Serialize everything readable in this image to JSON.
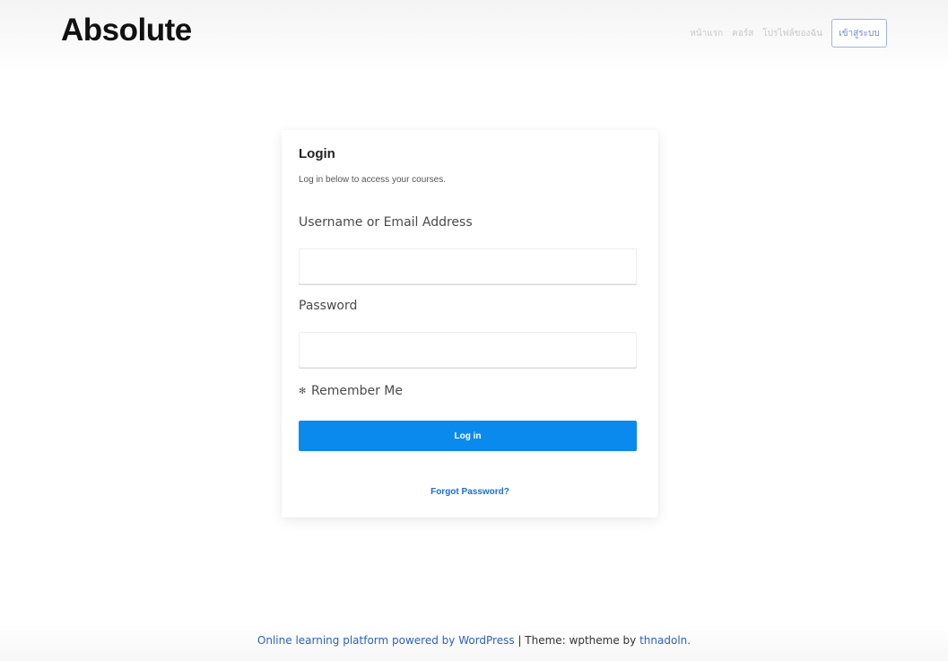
{
  "header": {
    "logo": "Absolute",
    "nav_links": [
      "หน้าแรก",
      "คอร์ส",
      "โปรไฟล์ของฉัน"
    ],
    "nav_button": "เข้าสู่ระบบ"
  },
  "login": {
    "title": "Login",
    "subtitle": "Log in below to access your courses.",
    "username_label": "Username or Email Address",
    "username_value": "",
    "password_label": "Password",
    "password_value": "",
    "remember_label": "Remember Me",
    "submit_label": "Log in",
    "forgot_label": "Forgot Password?"
  },
  "footer": {
    "powered_link": "Online learning platform powered by WordPress",
    "separator": " | Theme: wptheme by ",
    "author_link": "thnadoln."
  },
  "colors": {
    "primary_button": "#0b8aee",
    "link": "#2a62c8"
  }
}
